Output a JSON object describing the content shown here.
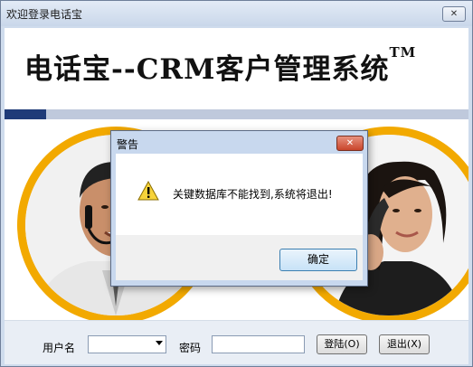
{
  "window": {
    "title": "欢迎登录电话宝",
    "close_glyph": "✕"
  },
  "banner": {
    "text": "电话宝--CRM客户管理系统",
    "trademark": "TM"
  },
  "login": {
    "username_label": "用户名",
    "password_label": "密码",
    "login_button": "登陆(O)",
    "exit_button": "退出(X)"
  },
  "dialog": {
    "title": "警告",
    "close_glyph": "✕",
    "message": "关键数据库不能找到,系统将退出!",
    "ok_button": "确定",
    "icon": "warning-icon"
  },
  "colors": {
    "ring": "#f2a900",
    "stripe_dark": "#1f3b78",
    "stripe_light": "#bfc9dc"
  }
}
